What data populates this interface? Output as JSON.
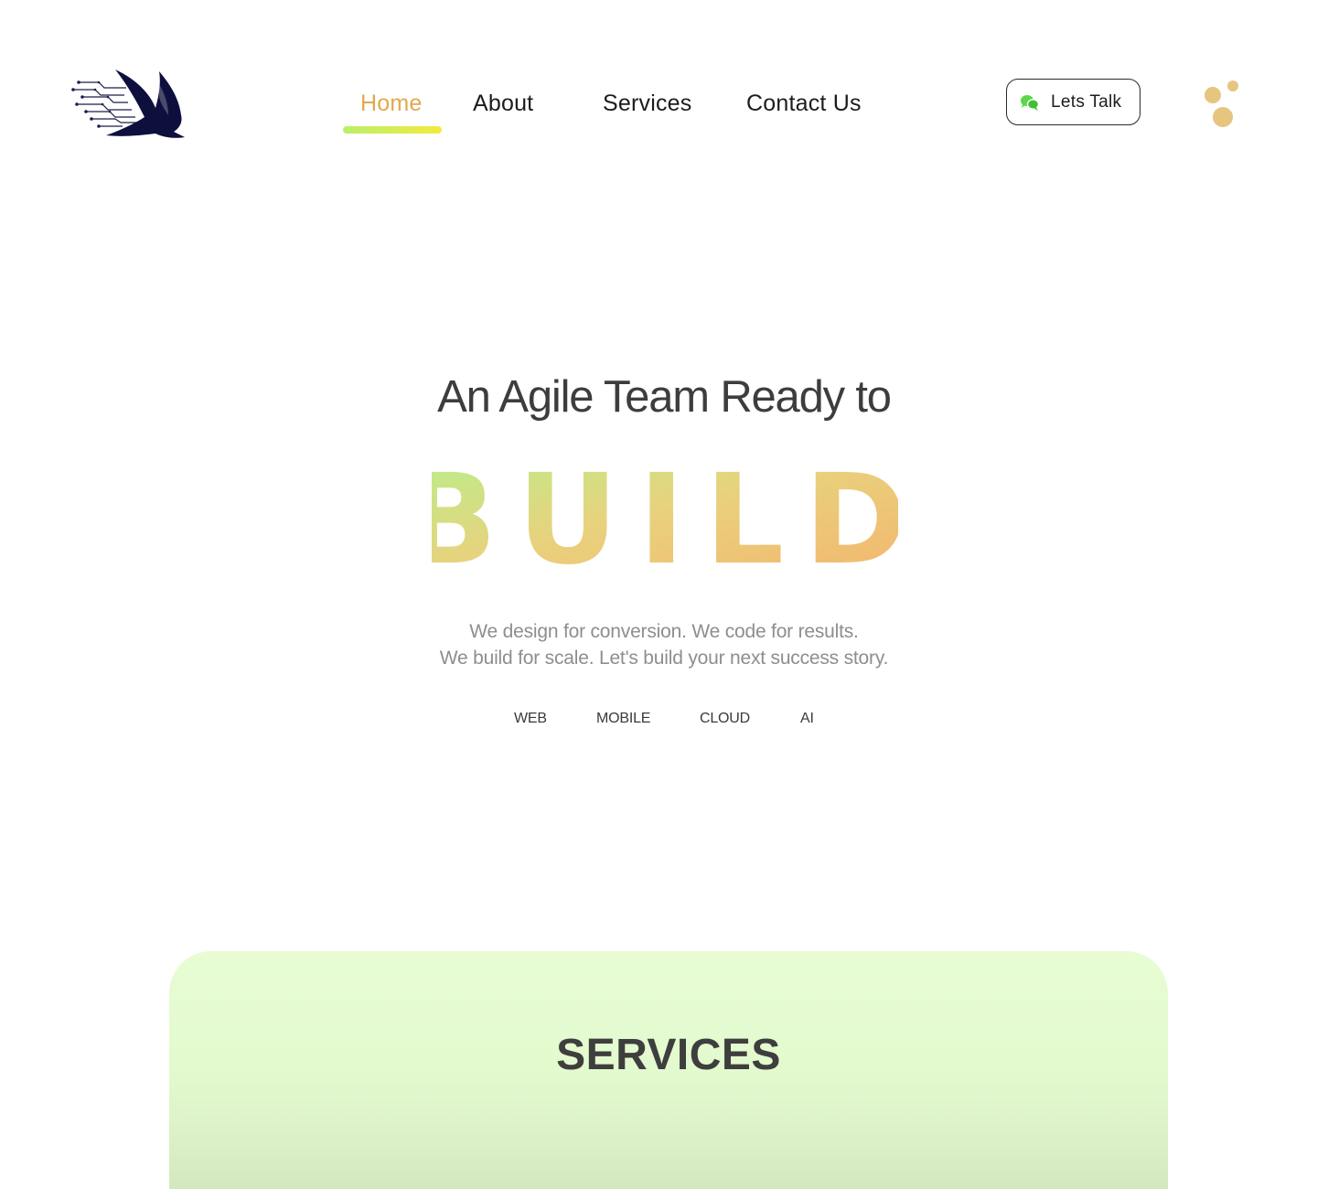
{
  "header": {
    "nav": {
      "home": "Home",
      "about": "About",
      "services": "Services",
      "contact": "Contact Us"
    },
    "active_nav": "Home",
    "cta_label": "Lets Talk",
    "cta_icon": "chat-bubbles-icon",
    "menu_icon": "dots-menu-icon"
  },
  "hero": {
    "heading": "An Agile Team Ready to",
    "highlight_word": "BUILD",
    "sub_line1": "We design for conversion. We code for results.",
    "sub_line2": "We build for scale. Let's build your next success story.",
    "tags": {
      "web": "WEB",
      "mobile": "MOBILE",
      "cloud": "CLOUD",
      "ai": "AI"
    }
  },
  "services": {
    "title": "SERVICES"
  },
  "colors": {
    "accent_orange": "#e1a94e",
    "underline_start": "#b8ef6a",
    "underline_end": "#f5ea3e",
    "build_gradient_start": "#b6f08c",
    "build_gradient_mid": "#e8d27d",
    "build_gradient_end": "#f5b26b",
    "services_bg": "#e5fad0",
    "logo_navy": "#0d0f3d",
    "chat_icon_green": "#5cd64a"
  }
}
